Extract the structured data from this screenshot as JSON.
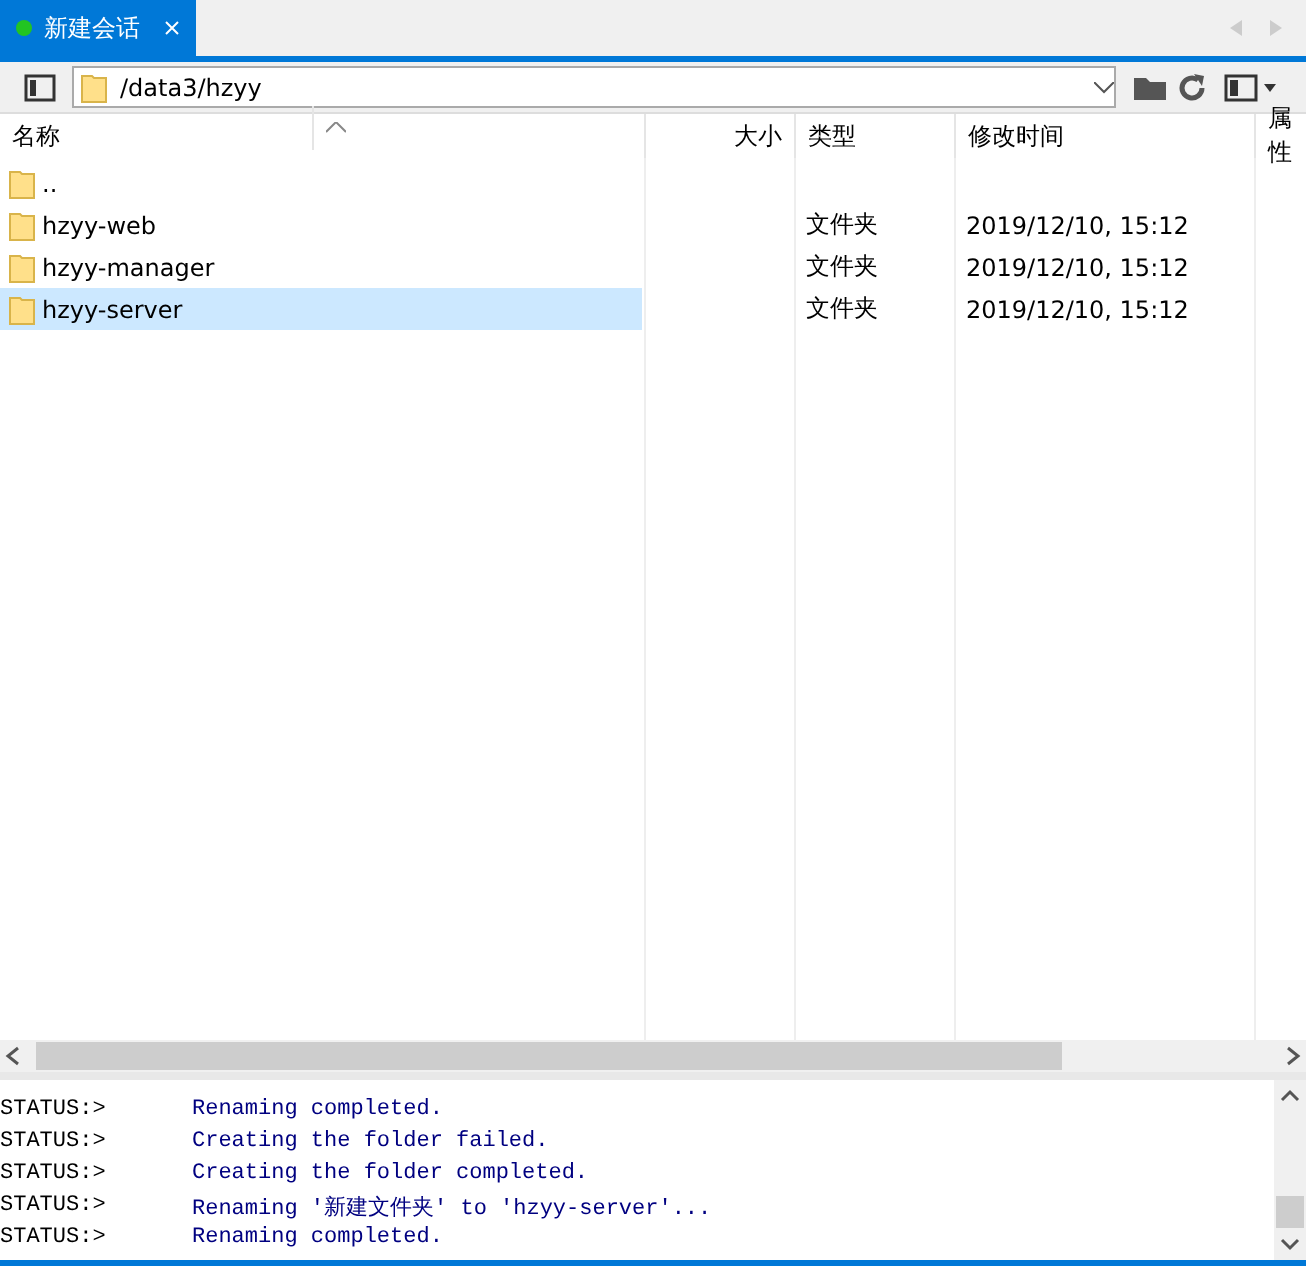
{
  "tabs": [
    {
      "label": "新建会话",
      "selected": true,
      "connected": true
    }
  ],
  "toolbar": {
    "path": "/data3/hzyy"
  },
  "file_list": {
    "columns": [
      "名称",
      "大小",
      "类型",
      "修改时间",
      "属性"
    ],
    "rows": [
      {
        "name": "..",
        "size": "",
        "type": "",
        "modified": "",
        "selected": false
      },
      {
        "name": "hzyy-web",
        "type": "文件夹",
        "modified": "2019/12/10, 15:12",
        "selected": false
      },
      {
        "name": "hzyy-manager",
        "type": "文件夹",
        "modified": "2019/12/10, 15:12",
        "selected": false
      },
      {
        "name": "hzyy-server",
        "type": "文件夹",
        "modified": "2019/12/10, 15:12",
        "selected": true
      }
    ]
  },
  "log": [
    {
      "prefix": "STATUS:>",
      "message": "Renaming completed."
    },
    {
      "prefix": "STATUS:>",
      "message": "Creating the folder failed."
    },
    {
      "prefix": "STATUS:>",
      "message": "Creating the folder completed."
    },
    {
      "prefix": "STATUS:>",
      "message": "Renaming '新建文件夹' to 'hzyy-server'..."
    },
    {
      "prefix": "STATUS:>",
      "message": "Renaming completed."
    }
  ]
}
